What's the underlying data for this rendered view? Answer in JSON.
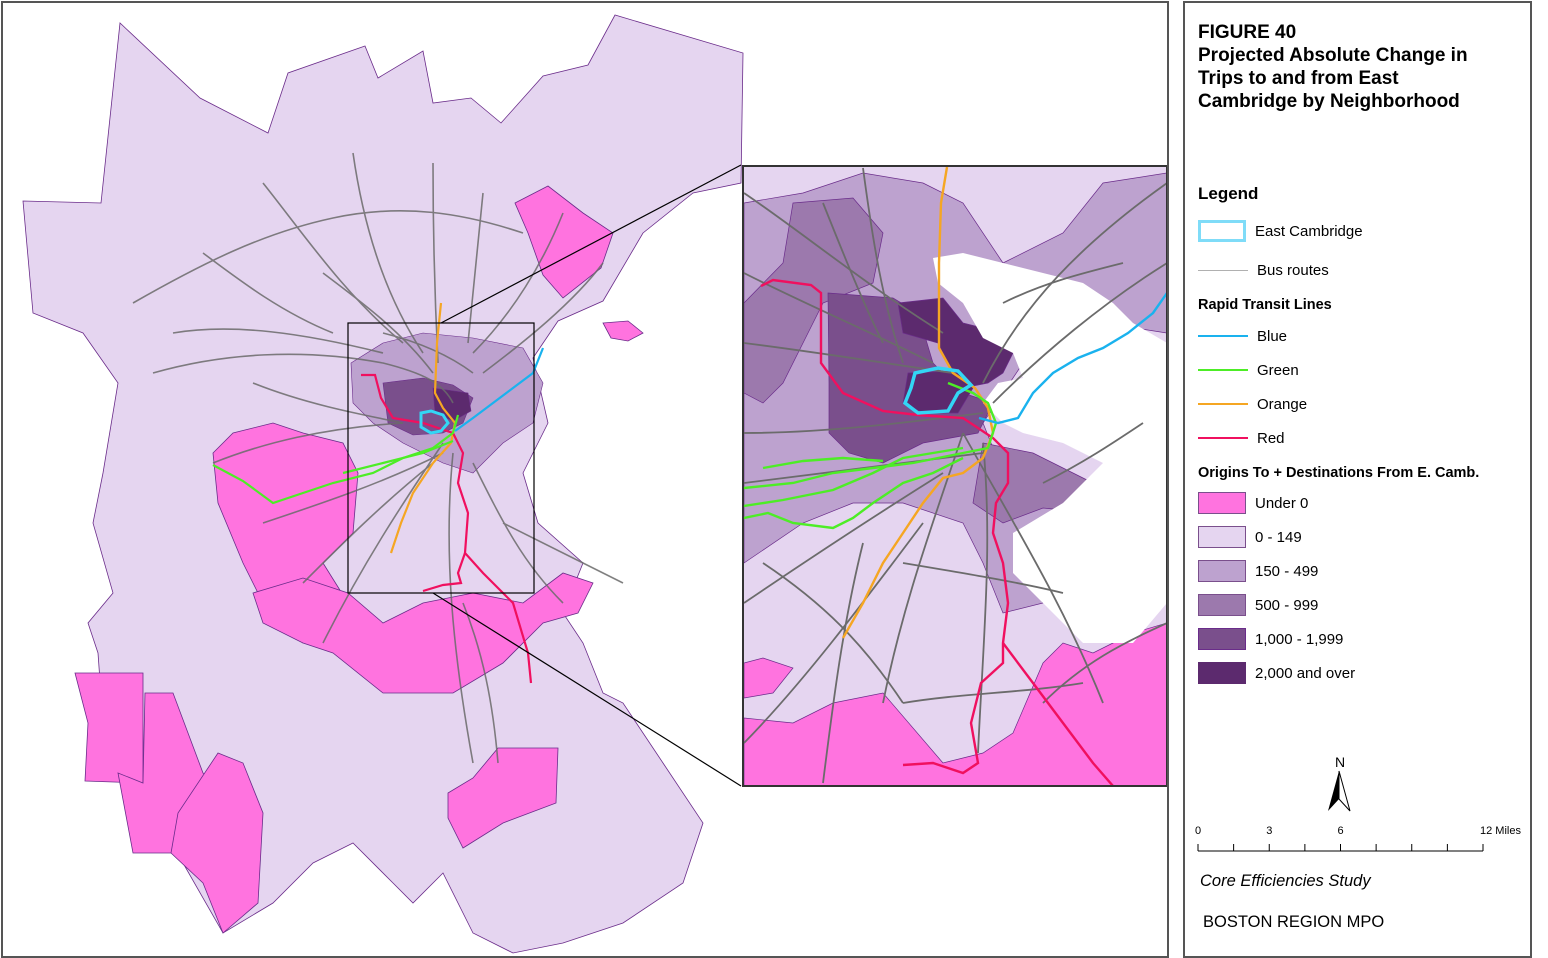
{
  "figure": {
    "number_label": "FIGURE 40",
    "title_lines": [
      "Projected Absolute Change in",
      "Trips to and from East",
      "Cambridge by Neighborhood"
    ]
  },
  "legend": {
    "heading": "Legend",
    "east_cambridge": {
      "label": "East Cambridge",
      "color": "#33d6f5"
    },
    "bus_routes": {
      "label": "Bus routes",
      "color": "#9a9a9a"
    },
    "rapid_transit_heading": "Rapid Transit Lines",
    "rapid_transit": [
      {
        "label": "Blue",
        "color": "#1ab2ee"
      },
      {
        "label": "Green",
        "color": "#4ded26"
      },
      {
        "label": "Orange",
        "color": "#f5a623"
      },
      {
        "label": "Red",
        "color": "#f0105f"
      }
    ],
    "classes_heading": "Origins To + Destinations From E. Camb.",
    "classes": [
      {
        "label": "Under 0",
        "color": "#ff73df"
      },
      {
        "label": "0 - 149",
        "color": "#e5d5f0"
      },
      {
        "label": "150 - 499",
        "color": "#bda2cf"
      },
      {
        "label": "500 - 999",
        "color": "#9c79ad"
      },
      {
        "label": "1,000 - 1,999",
        "color": "#7a4f8c"
      },
      {
        "label": "2,000 and over",
        "color": "#5c2a6e"
      }
    ]
  },
  "north_arrow": {
    "label": "N"
  },
  "scale_bar": {
    "ticks": [
      "0",
      "3",
      "6",
      "12 Miles"
    ],
    "max_miles": 12
  },
  "footer": {
    "study": "Core Efficiencies Study",
    "agency": "BOSTON REGION MPO"
  },
  "map": {
    "boundary_color": "#6a2c8a",
    "bus_color": "#6b6b6b",
    "frame_color": "#000000"
  }
}
